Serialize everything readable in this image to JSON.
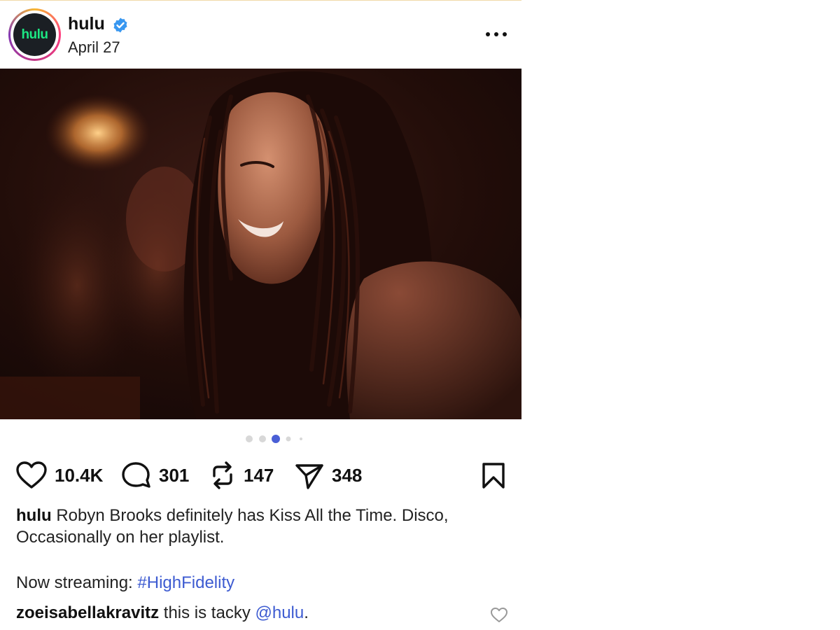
{
  "post": {
    "username": "hulu",
    "date": "April 27",
    "avatar_logo": "hulu",
    "verified_icon": "verified-badge-icon",
    "more_icon": "more-options-icon",
    "carousel": {
      "count": 5,
      "active_index": 2
    },
    "actions": {
      "likes": "10.4K",
      "comments": "301",
      "reposts": "147",
      "shares": "348"
    },
    "caption": {
      "author": "hulu",
      "text": "Robyn Brooks definitely has Kiss All the Time. Disco, Occasionally on her playlist."
    },
    "streaming": {
      "prefix": "Now streaming:",
      "hashtag": "#HighFidelity"
    },
    "comment": {
      "author": "zoeisabellakravitz",
      "text": "this is tacky",
      "mention": "@hulu",
      "suffix": "."
    }
  },
  "colors": {
    "link": "#3d5bd1",
    "verified": "#3897f0",
    "hulu_green": "#1ce783",
    "active_dot": "#4a5fd6"
  }
}
